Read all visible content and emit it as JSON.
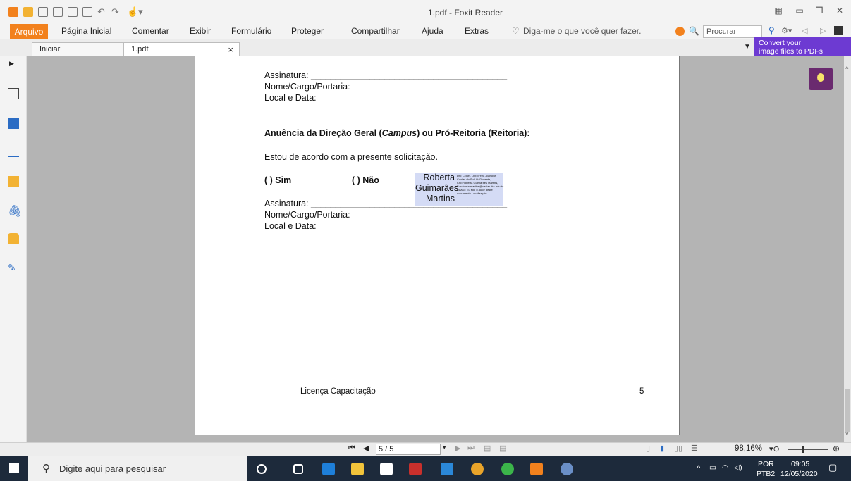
{
  "window": {
    "title": "1.pdf - Foxit Reader"
  },
  "menu": {
    "items": [
      "Arquivo",
      "Página Inicial",
      "Comentar",
      "Exibir",
      "Formulário",
      "Proteger",
      "Compartilhar",
      "Ajuda",
      "Extras"
    ],
    "tell_me": "Diga-me o que você quer fazer.",
    "search_placeholder": "Procurar"
  },
  "tabs": [
    {
      "label": "Iniciar"
    },
    {
      "label": "1.pdf",
      "close": "×"
    }
  ],
  "ad": {
    "line1": "Convert your",
    "line2": "image files to PDFs"
  },
  "document": {
    "sig1": "Assinatura: ________________________________________",
    "name1": "Nome/Cargo/Portaria:",
    "place1": "Local e Data:",
    "heading_part1": "Anuência da Direção Geral (",
    "heading_italic": "Campus",
    "heading_part2": ") ou Pró-Reitoria (Reitoria):",
    "agreement": "Estou de acordo com a presente solicitação.",
    "option_yes": "(  ) Sim",
    "option_no": "(  ) Não",
    "sig2": "Assinatura: ________________________________________",
    "name2": "Nome/Cargo/Portaria:",
    "place2": "Local e Data:",
    "signature_name": "Roberta Guimarães Martins",
    "signature_details": "DN: C=BR, OU=IFRS - campus Caxias do Sul, O=Docente, CN=Roberta Guimarães Martins, E=roberta.martins@caxias.ifrs.edu.br Razão: Eu sou o autor deste documento Localização:",
    "footer_title": "Licença Capacitação",
    "footer_page": "5"
  },
  "status": {
    "page": "5 / 5",
    "zoom": "98,16%"
  },
  "taskbar": {
    "search": "Digite aqui para pesquisar",
    "lang1": "POR",
    "lang2": "PTB2",
    "time": "09:05",
    "date": "12/05/2020"
  },
  "colors": {
    "accent": "#f2811d",
    "doc_background": "#b4b4b4",
    "taskbar": "#1d2a3b",
    "signature_bg": "#d4dbf5",
    "ad_bg": "#6d3ad2"
  }
}
